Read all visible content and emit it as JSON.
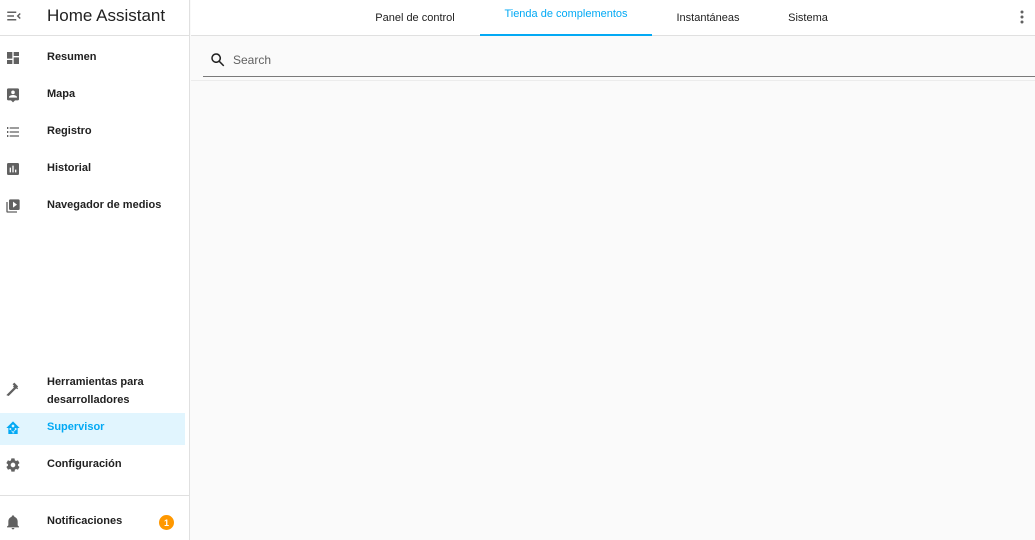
{
  "app": {
    "title": "Home Assistant"
  },
  "sidebar": {
    "items": [
      {
        "label": "Resumen",
        "icon": "dashboard-icon"
      },
      {
        "label": "Mapa",
        "icon": "map-account-icon"
      },
      {
        "label": "Registro",
        "icon": "format-list-icon"
      },
      {
        "label": "Historial",
        "icon": "chart-box-icon"
      },
      {
        "label": "Navegador de medios",
        "icon": "play-box-multiple-icon"
      }
    ],
    "bottom_items": [
      {
        "label": "Herramientas para desarrolladores",
        "icon": "hammer-icon"
      },
      {
        "label": "Supervisor",
        "icon": "home-assistant-icon",
        "active": true
      },
      {
        "label": "Configuración",
        "icon": "cog-icon"
      }
    ],
    "notifications": {
      "label": "Notificaciones",
      "count": "1",
      "icon": "bell-icon"
    }
  },
  "tabs": [
    {
      "label": "Panel de control"
    },
    {
      "label": "Tienda de complementos",
      "active": true
    },
    {
      "label": "Instantáneas"
    },
    {
      "label": "Sistema"
    }
  ],
  "search": {
    "placeholder": "Search",
    "value": ""
  },
  "colors": {
    "accent": "#03a9f4",
    "active_bg": "#e1f5fe",
    "badge": "#ff9800",
    "background": "#fafafa"
  }
}
